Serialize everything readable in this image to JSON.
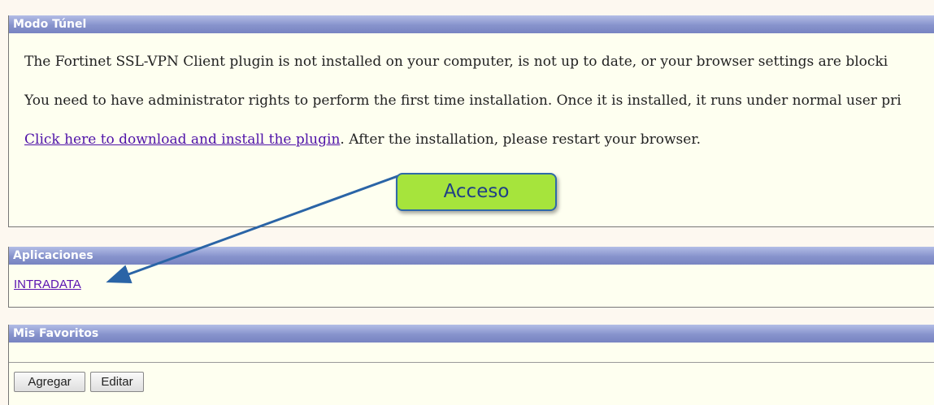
{
  "tunnel": {
    "header": "Modo Túnel",
    "line1": "The Fortinet SSL-VPN Client plugin is not installed on your computer, is not up to date, or your browser settings are blocki",
    "line2": "You need to have administrator rights to perform the first time installation. Once it is installed, it runs under normal user pri",
    "download_link": "Click here to download and install the plugin",
    "line3_rest": ". After the installation, please restart your browser."
  },
  "annotation": {
    "label": "Acceso",
    "fill_color": "#a6e43c",
    "border_color": "#2f6aa8",
    "arrow_color": "#2a64a6"
  },
  "apps": {
    "header": "Aplicaciones",
    "items": [
      "INTRADATA"
    ]
  },
  "favorites": {
    "header": "Mis Favoritos",
    "add_label": "Agregar",
    "edit_label": "Editar"
  }
}
